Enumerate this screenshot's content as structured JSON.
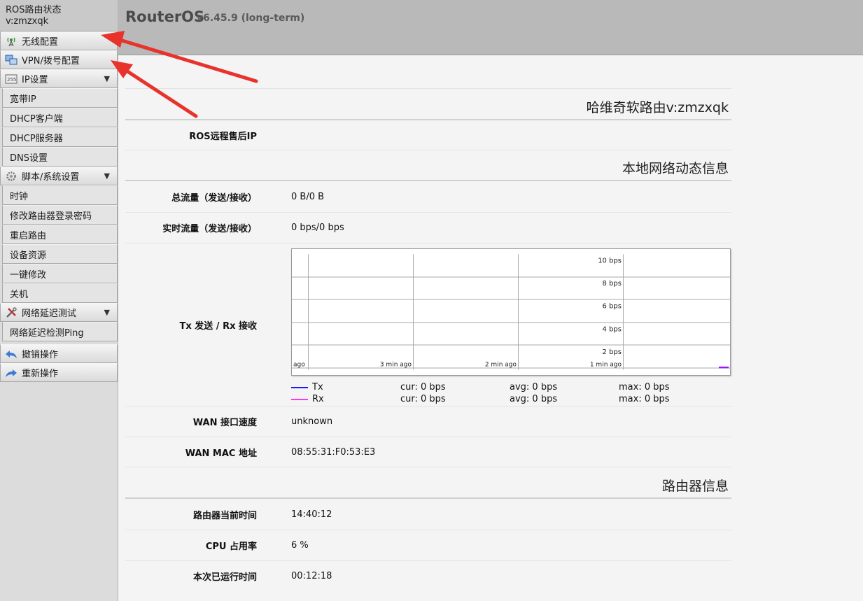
{
  "sidebar": {
    "title_line1": "ROS路由状态",
    "title_line2": "v:zmzxqk",
    "wireless": "无线配置",
    "vpn": "VPN/拨号配置",
    "ip": {
      "label": "IP设置",
      "arrow": "▼",
      "items": [
        "宽带IP",
        "DHCP客户端",
        "DHCP服务器",
        "DNS设置"
      ]
    },
    "script": {
      "label": "脚本/系统设置",
      "arrow": "▼",
      "items": [
        "时钟",
        "修改路由器登录密码",
        "重启路由",
        "设备资源",
        "一键修改",
        "关机"
      ]
    },
    "latency": {
      "label": "网络延迟测试",
      "arrow": "▼",
      "items": [
        "网络延迟检测Ping"
      ]
    },
    "undo": "撤销操作",
    "redo": "重新操作"
  },
  "header": {
    "brand": "RouterOS",
    "version": "v6.45.9 (long-term)"
  },
  "main": {
    "section1_title": "哈维奇软路由v:zmzxqk",
    "remote_ip_label": "ROS远程售后IP",
    "remote_ip_value": "",
    "section2_title": "本地网络动态信息",
    "total_label": "总流量（发送/接收）",
    "total_value": "0 B/0 B",
    "realtime_label": "实时流量（发送/接收）",
    "realtime_value": "0 bps/0 bps",
    "graph_label": "Tx 发送 / Rx 接收",
    "wan_speed_label": "WAN 接口速度",
    "wan_speed_value": "unknown",
    "wan_mac_label": "WAN MAC 地址",
    "wan_mac_value": "08:55:31:F0:53:E3",
    "section3_title": "路由器信息",
    "time_label": "路由器当前时间",
    "time_value": "14:40:12",
    "cpu_label": "CPU 占用率",
    "cpu_value": "6 %",
    "uptime_label": "本次已运行时间",
    "uptime_value": "00:12:18"
  },
  "legend": {
    "tx": {
      "name": "Tx",
      "cur": "cur: 0 bps",
      "avg": "avg: 0 bps",
      "max": "max: 0 bps",
      "color": "#1a1aff"
    },
    "rx": {
      "name": "Rx",
      "cur": "cur: 0 bps",
      "avg": "avg: 0 bps",
      "max": "max: 0 bps",
      "color": "#ff33ff"
    }
  },
  "chart_data": {
    "type": "line",
    "y_ticks": [
      "10 bps",
      "8 bps",
      "6 bps",
      "4 bps",
      "2 bps"
    ],
    "x_ticks": [
      "ago",
      "3 min ago",
      "2 min ago",
      "1 min ago"
    ],
    "ylim": [
      0,
      10
    ],
    "series": [
      {
        "name": "Tx",
        "values": [
          0,
          0
        ],
        "color": "#1a1aff"
      },
      {
        "name": "Rx",
        "values": [
          0,
          0
        ],
        "color": "#ff33ff"
      }
    ]
  },
  "colors": {
    "arrow": "#e8322c"
  },
  "icons": {
    "wireless": "antenna-icon",
    "vpn": "network-icon",
    "ip": "ip-icon",
    "script": "gear-icon",
    "latency": "tools-icon",
    "undo": "undo-icon",
    "redo": "redo-icon"
  }
}
